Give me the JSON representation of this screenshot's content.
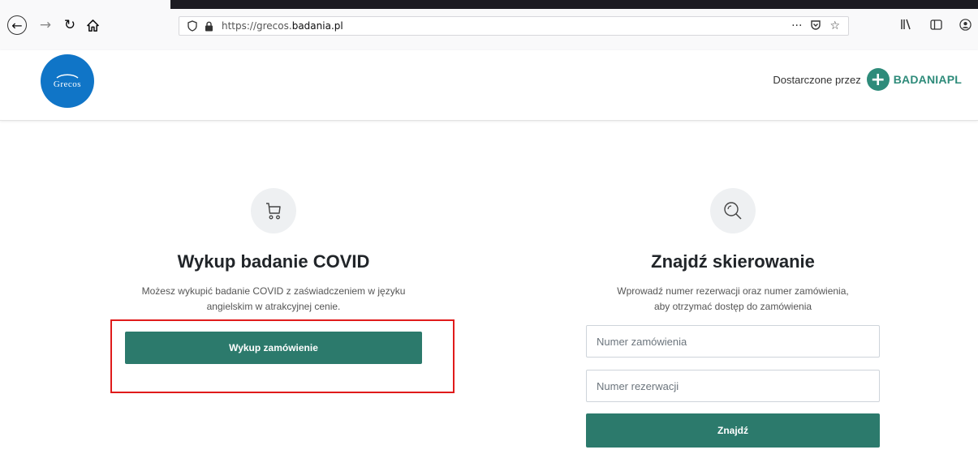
{
  "browser": {
    "url_prefix": "https://grecos.",
    "url_domain": "badania.pl",
    "icons": [
      "back-icon",
      "forward-icon",
      "reload-icon",
      "home-icon",
      "shield-icon",
      "lock-icon",
      "more-icon",
      "pocket-icon",
      "star-icon",
      "library-icon",
      "sidebar-icon",
      "account-icon"
    ]
  },
  "header": {
    "logo_text": "Grecos",
    "provided_by": "Dostarczone przez",
    "brand": "BADANIAPL",
    "brand_color": "#2e8b7a"
  },
  "buy_card": {
    "title": "Wykup badanie COVID",
    "desc_line1": "Możesz wykupić badanie COVID z zaświadczeniem w języku",
    "desc_line2": "angielskim w atrakcyjnej cenie.",
    "button": "Wykup zamówienie"
  },
  "find_card": {
    "title": "Znajdź skierowanie",
    "desc_line1": "Wprowadź numer rezerwacji oraz numer zamówienia,",
    "desc_line2": "aby otrzymać dostęp do zamówienia",
    "order_placeholder": "Numer zamówienia",
    "reservation_placeholder": "Numer rezerwacji",
    "button": "Znajdź"
  },
  "colors": {
    "accent": "#2c7a6c",
    "highlight": "#e01b1b",
    "logo_bg": "#1075c7"
  }
}
